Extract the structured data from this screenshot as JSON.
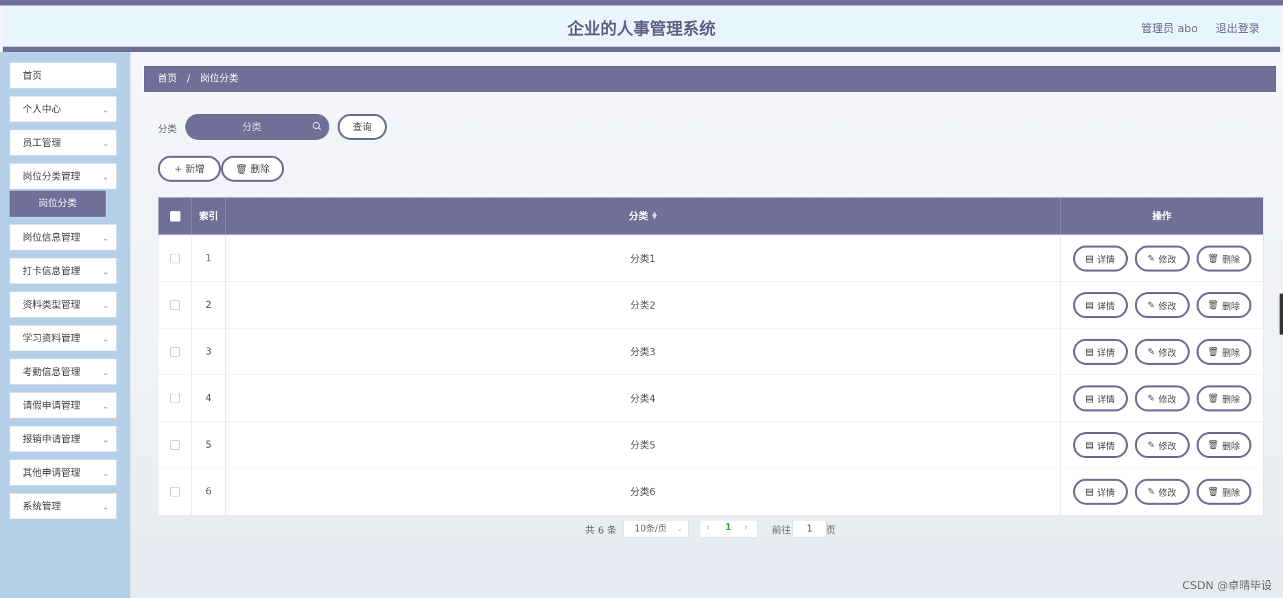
{
  "header": {
    "title": "企业的人事管理系统",
    "user": "管理员 abo",
    "logout": "退出登录"
  },
  "sidebar": {
    "items": [
      {
        "label": "首页",
        "chevron": false
      },
      {
        "label": "个人中心",
        "chevron": true
      },
      {
        "label": "员工管理",
        "chevron": true
      },
      {
        "label": "岗位分类管理",
        "chevron": true
      },
      {
        "label": "岗位信息管理",
        "chevron": true
      },
      {
        "label": "打卡信息管理",
        "chevron": true
      },
      {
        "label": "资料类型管理",
        "chevron": true
      },
      {
        "label": "学习资料管理",
        "chevron": true
      },
      {
        "label": "考勤信息管理",
        "chevron": true
      },
      {
        "label": "请假申请管理",
        "chevron": true
      },
      {
        "label": "报销申请管理",
        "chevron": true
      },
      {
        "label": "其他申请管理",
        "chevron": true
      },
      {
        "label": "系统管理",
        "chevron": true
      }
    ],
    "active_sub": "岗位分类"
  },
  "breadcrumb": {
    "home": "首页",
    "separator": "/",
    "current": "岗位分类"
  },
  "search": {
    "label": "分类",
    "placeholder": "分类",
    "button": "查询"
  },
  "actions": {
    "add": "新增",
    "delete": "删除"
  },
  "table": {
    "headers": {
      "index": "索引",
      "category": "分类",
      "operation": "操作"
    },
    "rows": [
      {
        "index": "1",
        "category": "分类1"
      },
      {
        "index": "2",
        "category": "分类2"
      },
      {
        "index": "3",
        "category": "分类3"
      },
      {
        "index": "4",
        "category": "分类4"
      },
      {
        "index": "5",
        "category": "分类5"
      },
      {
        "index": "6",
        "category": "分类6"
      }
    ],
    "row_actions": {
      "detail": "详情",
      "edit": "修改",
      "delete": "删除"
    }
  },
  "pagination": {
    "total": "共 6 条",
    "page_size": "10条/页",
    "current_page": "1",
    "goto_label": "前往",
    "goto_value": "1",
    "page_suffix": "页"
  },
  "watermark": "CSDN @卓晴毕设",
  "colors": {
    "primary": "#716f97",
    "sidebar_bg": "#b6cfe9",
    "header_bg": "#e9f5fd",
    "current_page": "#2aa84a"
  }
}
